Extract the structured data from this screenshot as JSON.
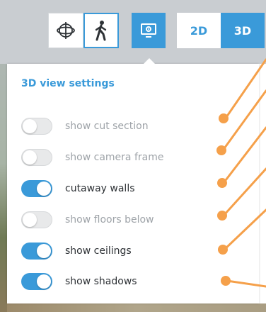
{
  "toolbar": {
    "orbit_icon": "orbit-icon",
    "walk_icon": "walking-person-icon",
    "settings_icon": "monitor-settings-icon",
    "view_2d_label": "2D",
    "view_3d_label": "3D",
    "active_view": "3D"
  },
  "panel": {
    "title": "3D view settings",
    "items": [
      {
        "label": "show cut section",
        "on": false
      },
      {
        "label": "show camera frame",
        "on": false
      },
      {
        "label": "cutaway walls",
        "on": true
      },
      {
        "label": "show floors below",
        "on": false
      },
      {
        "label": "show ceilings",
        "on": true
      },
      {
        "label": "show shadows",
        "on": true
      }
    ]
  },
  "colors": {
    "accent": "#3a9ad9",
    "annotation": "#f5a04a",
    "toggle_off": "#e8e9ea",
    "text_dim": "#9ea3a8",
    "text_dark": "#2e3236"
  }
}
